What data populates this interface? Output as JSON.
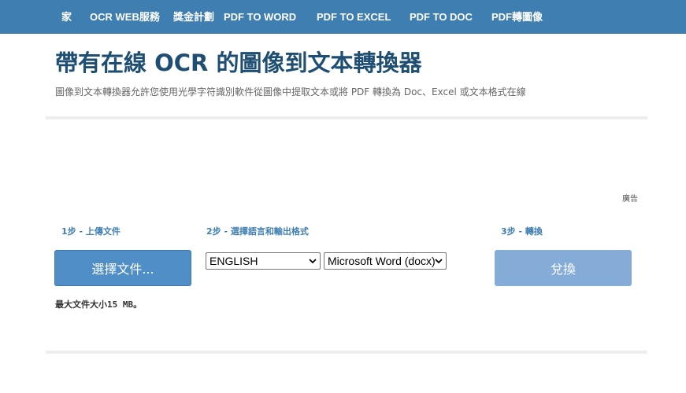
{
  "nav": {
    "items": [
      {
        "label": "家"
      },
      {
        "label": "OCR WEB服務"
      },
      {
        "label": "獎金計劃"
      },
      {
        "label": "PDF TO WORD"
      },
      {
        "label": "PDF TO EXCEL"
      },
      {
        "label": "PDF TO DOC"
      },
      {
        "label": "PDF轉圖像"
      }
    ]
  },
  "header": {
    "title": "帶有在線 OCR 的圖像到文本轉換器",
    "subtitle": "圖像到文本轉換器允許您使用光學字符識別軟件從圖像中提取文本或將 PDF 轉換為 Doc、Excel 或文本格式在線"
  },
  "ad": {
    "label": "廣告"
  },
  "steps": {
    "step1": "1步 - 上傳文件",
    "step2": "2步 - 選擇語言和輸出格式",
    "step3": "3步 - 轉換"
  },
  "upload": {
    "button_label": "選擇文件...",
    "max_size_note": "最大文件大小15 MB。"
  },
  "options": {
    "language_selected": "ENGLISH",
    "format_selected": "Microsoft Word (docx)"
  },
  "convert": {
    "button_label": "兌換"
  },
  "colors": {
    "nav_bg": "#3e7eb0",
    "title": "#1e4f72",
    "primary_button": "#4f8ec7",
    "convert_button": "#84acd6",
    "step_label": "#3f7fb4"
  }
}
